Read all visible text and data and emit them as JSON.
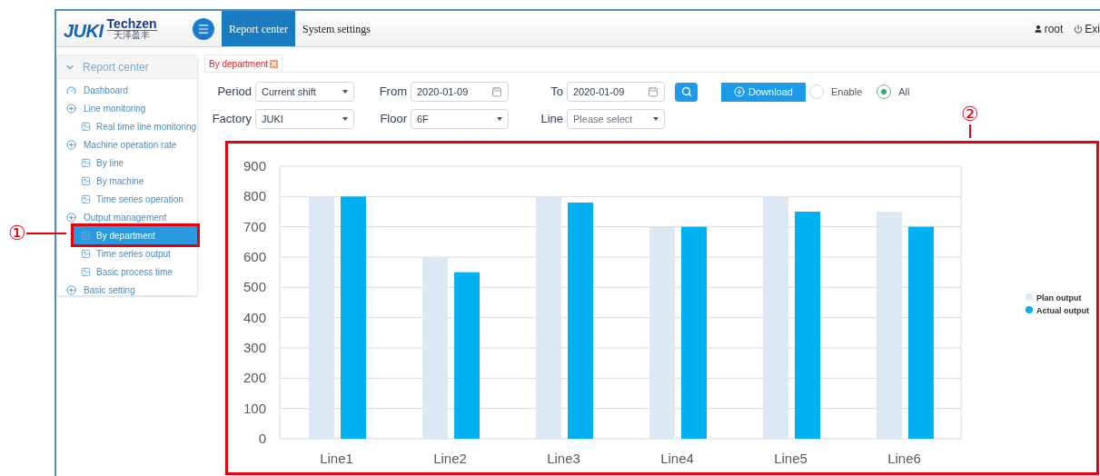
{
  "header": {
    "logo": {
      "brand": "JUKI",
      "sub_brand": "Techzen",
      "sub_brand_cn": "天泽盈丰"
    },
    "nav_tabs": [
      {
        "label": "Report center",
        "selected": true
      },
      {
        "label": "System settings",
        "selected": false
      }
    ],
    "user": "root",
    "exit": "Exi"
  },
  "sidebar": {
    "title": "Report center",
    "items": [
      {
        "label": "Dashboard",
        "kind": "dashboard",
        "selected": false
      },
      {
        "label": "Line monitoring",
        "kind": "group",
        "selected": false,
        "children": [
          {
            "label": "Real time line monitoring",
            "kind": "report",
            "selected": false
          }
        ]
      },
      {
        "label": "Machine operation rate",
        "kind": "group",
        "selected": false,
        "children": [
          {
            "label": "By line",
            "kind": "report",
            "selected": false
          },
          {
            "label": "By machine",
            "kind": "report",
            "selected": false
          },
          {
            "label": "Time series operation",
            "kind": "report",
            "selected": false
          }
        ]
      },
      {
        "label": "Output management",
        "kind": "group",
        "selected": false,
        "children": [
          {
            "label": "By department",
            "kind": "report",
            "selected": true,
            "callout": "①"
          },
          {
            "label": "Time series output",
            "kind": "report",
            "selected": false
          },
          {
            "label": "Basic process time",
            "kind": "report",
            "selected": false
          }
        ]
      },
      {
        "label": "Basic setting",
        "kind": "group",
        "selected": false
      }
    ]
  },
  "content_tabs": [
    {
      "label": "By department",
      "selected": true
    }
  ],
  "filters": {
    "period": {
      "label": "Period",
      "value": "Current shift"
    },
    "from": {
      "label": "From",
      "value": "2020-01-09"
    },
    "to": {
      "label": "To",
      "value": "2020-01-09"
    },
    "download": "Download",
    "radios": [
      {
        "label": "Enable",
        "selected": false
      },
      {
        "label": "All",
        "selected": true
      }
    ],
    "factory": {
      "label": "Factory",
      "value": "JUKI"
    },
    "floor": {
      "label": "Floor",
      "value": "6F"
    },
    "line": {
      "label": "Line",
      "placeholder": "Please select"
    }
  },
  "chart": {
    "callout": "②",
    "chart_data": {
      "type": "bar",
      "grid": true,
      "legend": true,
      "categories": [
        "Line1",
        "Line2",
        "Line3",
        "Line4",
        "Line5",
        "Line6"
      ],
      "ylim": [
        0,
        900
      ],
      "yticks": [
        0,
        100,
        200,
        300,
        400,
        500,
        600,
        700,
        800,
        900
      ],
      "series": [
        {
          "name": "Plan output",
          "color": "#dce8f4",
          "values": [
            800,
            600,
            800,
            700,
            800,
            750
          ]
        },
        {
          "name": "Actual output",
          "color": "#00b0f0",
          "values": [
            800,
            550,
            780,
            700,
            750,
            700
          ]
        }
      ]
    }
  }
}
